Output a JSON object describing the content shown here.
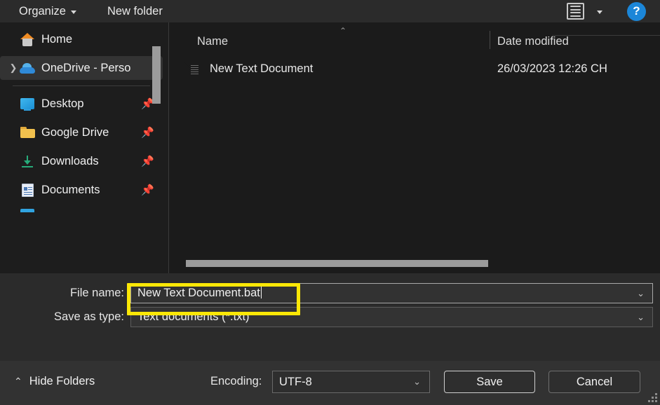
{
  "toolbar": {
    "organize_label": "Organize",
    "new_folder_label": "New folder",
    "view_icon": "list-view-icon",
    "help_label": "?"
  },
  "nav_pane": {
    "items": [
      {
        "label": "Home",
        "icon": "home-icon",
        "selected": false,
        "pinned": false,
        "expandable": false
      },
      {
        "label": "OneDrive - Perso",
        "icon": "onedrive-cloud-icon",
        "selected": true,
        "pinned": false,
        "expandable": true
      },
      {
        "label": "Desktop",
        "icon": "desktop-icon",
        "selected": false,
        "pinned": true,
        "expandable": false
      },
      {
        "label": "Google Drive",
        "icon": "folder-icon",
        "selected": false,
        "pinned": true,
        "expandable": false
      },
      {
        "label": "Downloads",
        "icon": "download-arrow-icon",
        "selected": false,
        "pinned": true,
        "expandable": false
      },
      {
        "label": "Documents",
        "icon": "documents-icon",
        "selected": false,
        "pinned": true,
        "expandable": false
      }
    ]
  },
  "file_list": {
    "columns": [
      "Name",
      "Date modified"
    ],
    "sort_indicator": "⌃",
    "rows": [
      {
        "name": "New Text Document",
        "date_modified": "26/03/2023 12:26 CH",
        "icon": "text-file-icon"
      }
    ]
  },
  "form": {
    "file_name_label": "File name:",
    "file_name_value": "New Text Document.bat",
    "save_as_type_label": "Save as type:",
    "save_as_type_value": "Text documents (*.txt)",
    "chevron": "⌄"
  },
  "footer": {
    "hide_folders_label": "Hide Folders",
    "hide_folders_chevron": "⌃",
    "encoding_label": "Encoding:",
    "encoding_value": "UTF-8",
    "save_label": "Save",
    "cancel_label": "Cancel"
  },
  "colors": {
    "highlight_box": "#fbe706",
    "accent_help": "#1b86d8",
    "window_bg": "#202020",
    "form_bg": "#2b2b2b",
    "footer_bg": "#323232"
  }
}
